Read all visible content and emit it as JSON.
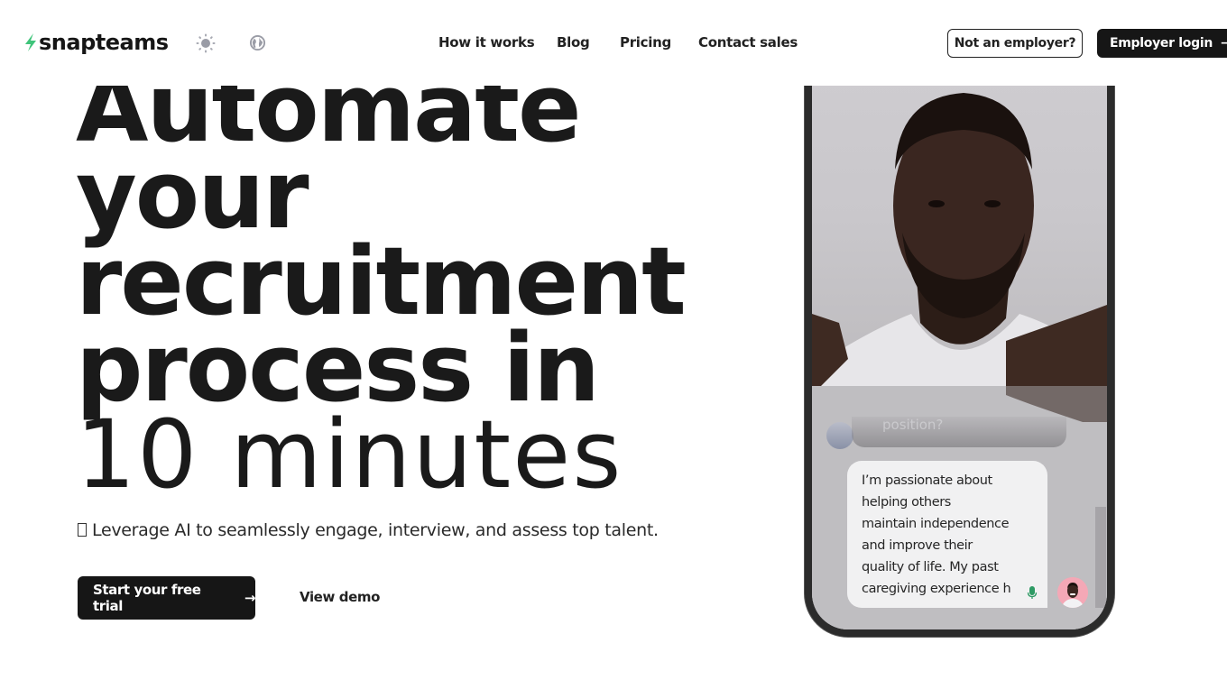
{
  "header": {
    "brand": "snapteams",
    "icons": {
      "logo": "lightning-bolt-icon",
      "theme": "sun-icon",
      "language": "globe-icon"
    },
    "nav": [
      {
        "label": "How it works"
      },
      {
        "label": "Blog"
      },
      {
        "label": "Pricing"
      },
      {
        "label": "Contact sales"
      }
    ],
    "not_employer_label": "Not an employer?",
    "employer_login_label": "Employer login",
    "arrow": "→"
  },
  "hero": {
    "title_lines": [
      "Automate",
      "your",
      "recruitment",
      "process in"
    ],
    "title_light": "10 minutes",
    "subtitle": "Leverage AI to seamlessly engage, interview, and assess top talent.",
    "primary_cta": "Start your free trial",
    "secondary_cta": "View demo",
    "arrow": "→"
  },
  "phone": {
    "question_fragment": "position?",
    "answer_lines": [
      "I’m passionate about",
      "helping others",
      "maintain independence",
      "and improve their",
      "quality of life. My past",
      "caregiving experience h"
    ],
    "colors": {
      "brand_green": "#3fc47a",
      "mic_green": "#2e9a64",
      "avatar_pink": "#f4a8b6"
    }
  }
}
